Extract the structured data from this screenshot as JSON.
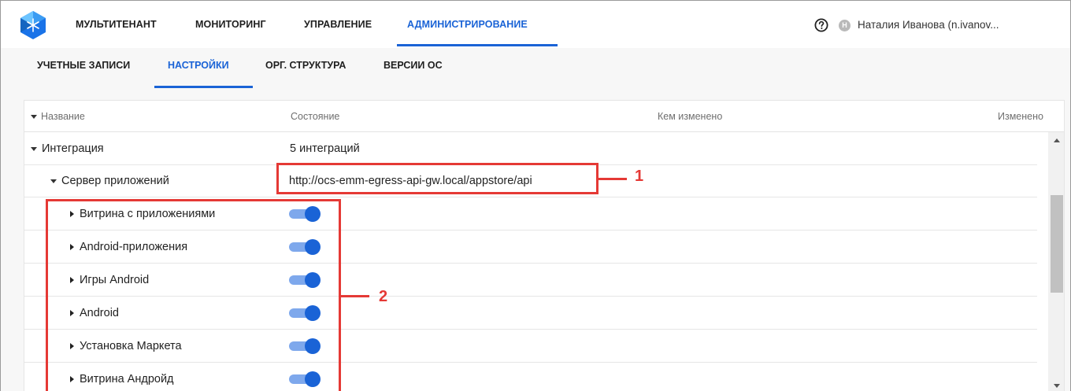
{
  "header": {
    "nav": [
      "МУЛЬТИТЕНАНТ",
      "МОНИТОРИНГ",
      "УПРАВЛЕНИЕ",
      "АДМИНИСТРИРОВАНИЕ"
    ],
    "active_nav": "АДМИНИСТРИРОВАНИЕ",
    "help_icon": "question-circle-icon",
    "user_initial": "Н",
    "user_name": "Наталия Иванова (n.ivanov..."
  },
  "subnav": {
    "items": [
      "УЧЕТНЫЕ ЗАПИСИ",
      "НАСТРОЙКИ",
      "ОРГ. СТРУКТУРА",
      "ВЕРСИИ ОС"
    ],
    "active": "НАСТРОЙКИ"
  },
  "table": {
    "columns": [
      "Название",
      "Состояние",
      "Кем изменено",
      "Изменено"
    ],
    "rows": [
      {
        "name": "Интеграция",
        "state": "5 интеграций"
      },
      {
        "name": "Сервер приложений",
        "state": "http://ocs-emm-egress-api-gw.local/appstore/api"
      },
      {
        "name": "Витрина с приложениями",
        "toggle": true
      },
      {
        "name": "Android-приложения",
        "toggle": true
      },
      {
        "name": "Игры Android",
        "toggle": true
      },
      {
        "name": "Android",
        "toggle": true
      },
      {
        "name": "Установка Маркета",
        "toggle": true
      },
      {
        "name": "Витрина Андройд",
        "toggle": true
      }
    ]
  },
  "annotations": {
    "label_1": "1",
    "label_2": "2"
  },
  "colors": {
    "accent": "#1a63d6",
    "annotation": "#e53935",
    "toggle_track": "#7ea8ec"
  }
}
